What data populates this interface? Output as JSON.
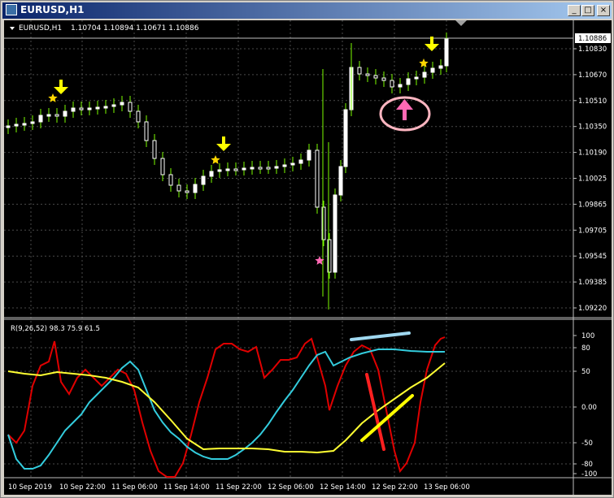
{
  "window": {
    "title": "EURUSD,H1",
    "buttons": {
      "minimize": "_",
      "maximize": "□",
      "close": "×"
    }
  },
  "chart": {
    "info_symbol": "EURUSD,H1",
    "info_ohlc": "1.10704 1.10894 1.10671 1.10886",
    "current_price": "1.10886",
    "price_ticks": [
      "1.10830",
      "1.10670",
      "1.10510",
      "1.10350",
      "1.10190",
      "1.10025",
      "1.09865",
      "1.09705",
      "1.09545",
      "1.09385",
      "1.09220"
    ],
    "indicator_label": "R(9,26,52) 98.3 75.9 61.5",
    "indicator_ticks": [
      "100",
      "80",
      "50",
      "0.00",
      "-50",
      "-80",
      "-100"
    ],
    "time_ticks": [
      "10 Sep 2019",
      "10 Sep 22:00",
      "11 Sep 06:00",
      "11 Sep 14:00",
      "11 Sep 22:00",
      "12 Sep 06:00",
      "12 Sep 14:00",
      "12 Sep 22:00",
      "13 Sep 06:00"
    ],
    "colors": {
      "background": "#000000",
      "grid": "#4a4a4a",
      "candle": "#ffffff",
      "wick": "#7cfc00",
      "signal_arrow_down": "#ffff00",
      "signal_star": "#ffd700",
      "signal_arrow_up": "#ff69b4",
      "circle": "#ffb6c1",
      "line_fast": "#e00000",
      "line_mid": "#33ccdd",
      "line_slow": "#ffff33"
    }
  }
}
